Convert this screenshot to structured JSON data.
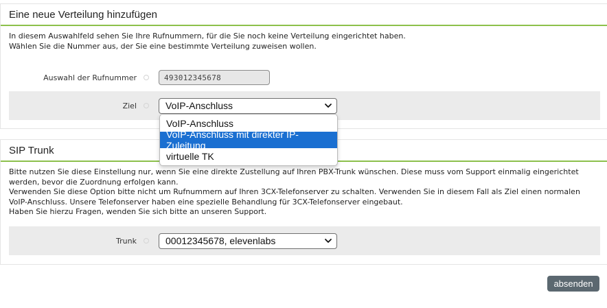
{
  "section_distribution": {
    "title": "Eine neue Verteilung hinzufügen",
    "description_lines": [
      "In diesem Auswahlfeld sehen Sie Ihre Rufnummern, für die Sie noch keine Verteilung eingerichtet haben.",
      "Wählen Sie die Nummer aus, der Sie eine bestimmte Verteilung zuweisen wollen."
    ],
    "number_label": "Auswahl der Rufnummer",
    "number_value": "493012345678",
    "target_label": "Ziel",
    "target_selected": "VoIP-Anschluss",
    "target_options": [
      "VoIP-Anschluss",
      "VoIP-Anschluss mit direkter IP-Zuleitung",
      "virtuelle TK"
    ],
    "highlighted_option": "VoIP-Anschluss mit direkter IP-Zuleitung"
  },
  "section_sip": {
    "title": "SIP Trunk",
    "description_lines": [
      "Bitte nutzen Sie diese Einstellung nur, wenn Sie eine direkte Zustellung auf Ihren PBX-Trunk wünschen. Diese muss vom Support einmalig eingerichtet",
      "werden, bevor die Zuordnung erfolgen kann.",
      "Verwenden Sie diese Option bitte nicht um Rufnummern auf Ihren 3CX-Telefonserver zu schalten. Verwenden Sie in diesem Fall als Ziel einen normalen",
      "VoIP-Anschluss. Unsere Telefonserver haben eine spezielle Behandlung für 3CX-Telefonserver eingebaut.",
      "Haben Sie hierzu Fragen, wenden Sie sich bitte an unseren Support."
    ],
    "trunk_label": "Trunk",
    "trunk_selected": "00012345678, elevenlabs"
  },
  "submit_label": "absenden",
  "colors": {
    "accent_line": "#8cc04b",
    "option_highlight": "#1a6fd1",
    "button_bg": "#5b6870"
  }
}
